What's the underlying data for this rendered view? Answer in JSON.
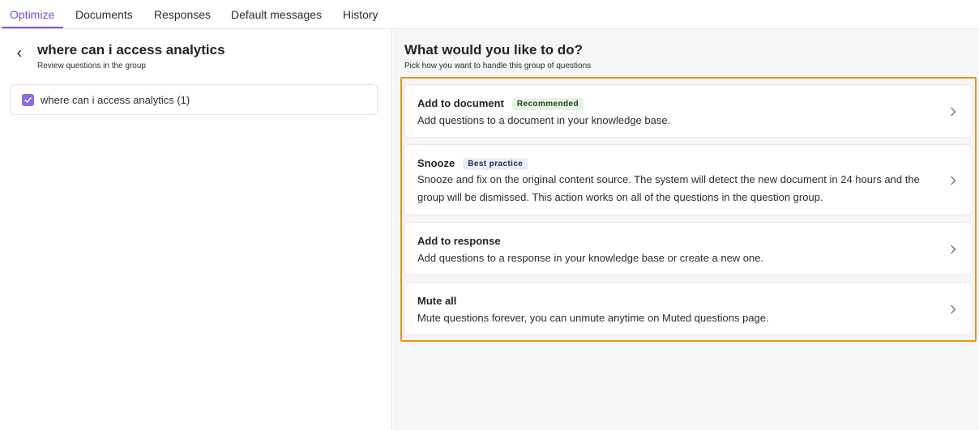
{
  "tabs": [
    {
      "label": "Optimize",
      "active": true
    },
    {
      "label": "Documents"
    },
    {
      "label": "Responses"
    },
    {
      "label": "Default messages"
    },
    {
      "label": "History"
    }
  ],
  "left": {
    "title": "where can i access analytics",
    "subtitle": "Review questions in the group",
    "questions": [
      {
        "label": "where can i access analytics (1)",
        "checked": true
      }
    ]
  },
  "right": {
    "title": "What would you like to do?",
    "subtitle": "Pick how you want to handle this group of questions",
    "options": [
      {
        "title": "Add to document",
        "badge": "Recommended",
        "description": "Add questions to a document in your knowledge base."
      },
      {
        "title": "Snooze",
        "badge": "Best practice",
        "description": "Snooze and fix on the original content source. The system will detect the new document in 24 hours and the group will be dismissed. This action works on all of the questions in the question group."
      },
      {
        "title": "Add to response",
        "description": "Add questions to a response in your knowledge base or create a new one."
      },
      {
        "title": "Mute all",
        "description": "Mute questions forever, you can unmute anytime on Muted questions page."
      }
    ]
  },
  "colors": {
    "accent": "#7c4fe0",
    "checkbox": "#8b6cf0",
    "highlight": "#f0920f",
    "badge_green": "#e6f4e6",
    "badge_blue": "#e8eefb"
  }
}
